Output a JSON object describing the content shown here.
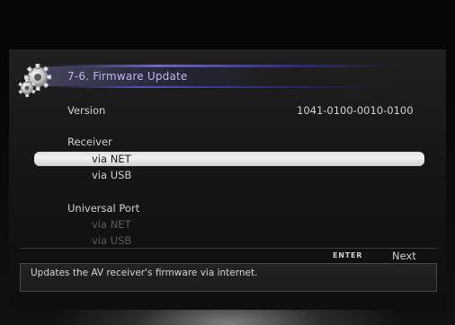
{
  "header": {
    "title": "7-6. Firmware Update",
    "icon": "gears-icon"
  },
  "version": {
    "label": "Version",
    "value": "1041-0100-0010-0100"
  },
  "receiver": {
    "heading": "Receiver",
    "items": [
      {
        "label": "via NET",
        "selected": true
      },
      {
        "label": "via USB",
        "selected": false
      }
    ]
  },
  "universal_port": {
    "heading": "Universal Port",
    "items": [
      {
        "label": "via NET",
        "enabled": false
      },
      {
        "label": "via USB",
        "enabled": false
      }
    ]
  },
  "footer": {
    "key_label": "ENTER",
    "key_action": "Next",
    "help_text": "Updates the AV receiver's firmware via internet."
  },
  "colors": {
    "title_accent": "#6f6fd0",
    "highlight": "#f0f0f0",
    "disabled_text": "#5a5a5a"
  }
}
